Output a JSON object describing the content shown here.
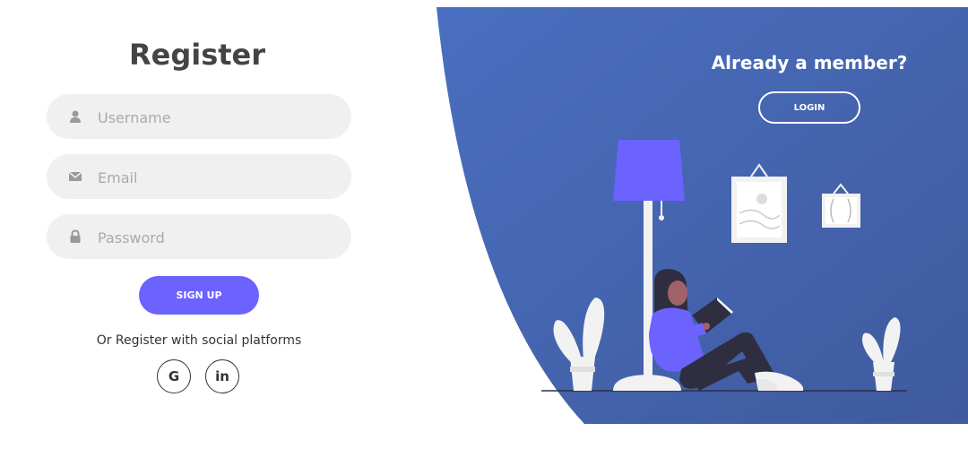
{
  "register": {
    "title": "Register",
    "username_placeholder": "Username",
    "email_placeholder": "Email",
    "password_placeholder": "Password",
    "signup_label": "SIGN UP",
    "social_text": "Or Register with social platforms",
    "google_label": "G",
    "linkedin_label": "in"
  },
  "side": {
    "heading": "Already a member?",
    "login_label": "LOGIN"
  },
  "colors": {
    "accent": "#6c63ff",
    "panel": "#4a64b0",
    "field_bg": "#f0f0f0"
  }
}
